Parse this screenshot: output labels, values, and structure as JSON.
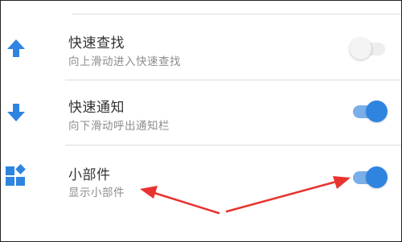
{
  "settings": {
    "items": [
      {
        "icon": "arrow-up-icon",
        "title": "快速查找",
        "subtitle": "向上滑动进入快速查找",
        "toggle_on": false
      },
      {
        "icon": "arrow-down-icon",
        "title": "快速通知",
        "subtitle": "向下滑动呼出通知栏",
        "toggle_on": true
      },
      {
        "icon": "widgets-icon",
        "title": "小部件",
        "subtitle": "显示小部件",
        "toggle_on": true
      }
    ]
  },
  "colors": {
    "accent": "#2f84e0",
    "annotation_arrow": "#e8332e"
  }
}
